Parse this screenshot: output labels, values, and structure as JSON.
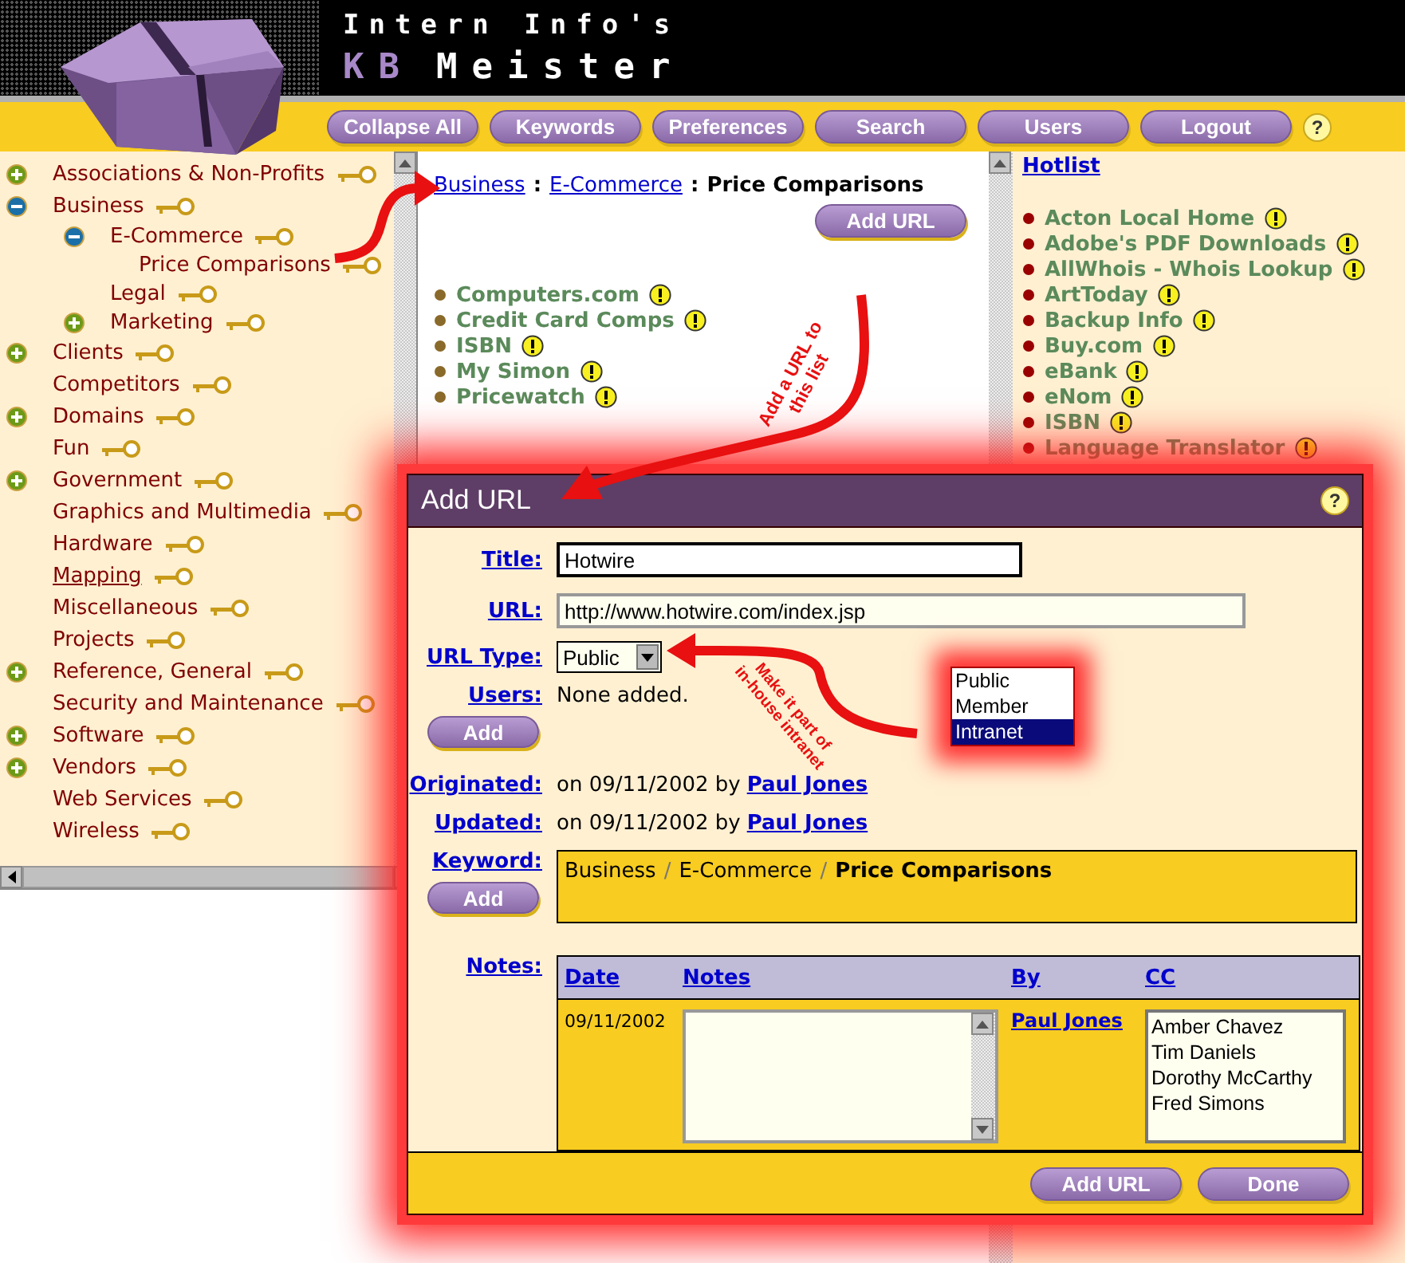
{
  "header": {
    "title": "Intern Info's",
    "product_prefix": "KB",
    "product_name": "Meister"
  },
  "toolbar": {
    "buttons": [
      "Collapse All",
      "Keywords",
      "Preferences",
      "Search",
      "Users",
      "Logout"
    ],
    "help": "?"
  },
  "tree": [
    {
      "label": "Associations & Non-Profits",
      "expanded": false,
      "hovered": false
    },
    {
      "label": "Business",
      "expanded": true,
      "hovered": false,
      "children": [
        {
          "label": "E-Commerce",
          "expanded": true,
          "hovered": false,
          "children": [
            {
              "label": "Price Comparisons",
              "hovered": false
            }
          ]
        },
        {
          "label": "Legal",
          "hovered": false
        },
        {
          "label": "Marketing",
          "expanded": false,
          "hovered": false
        }
      ]
    },
    {
      "label": "Clients",
      "expanded": false,
      "hovered": false
    },
    {
      "label": "Competitors",
      "hovered": false
    },
    {
      "label": "Domains",
      "expanded": false,
      "hovered": false
    },
    {
      "label": "Fun",
      "hovered": false
    },
    {
      "label": "Government",
      "expanded": false,
      "hovered": false
    },
    {
      "label": "Graphics and Multimedia",
      "hovered": false
    },
    {
      "label": "Hardware",
      "hovered": false
    },
    {
      "label": "Mapping",
      "hovered": true
    },
    {
      "label": "Miscellaneous",
      "hovered": false
    },
    {
      "label": "Projects",
      "hovered": false
    },
    {
      "label": "Reference, General",
      "expanded": false,
      "hovered": false
    },
    {
      "label": "Security and Maintenance",
      "hovered": false
    },
    {
      "label": "Software",
      "expanded": false,
      "hovered": false
    },
    {
      "label": "Vendors",
      "expanded": false,
      "hovered": false
    },
    {
      "label": "Web Services",
      "hovered": false
    },
    {
      "label": "Wireless",
      "hovered": false
    }
  ],
  "category": {
    "breadcrumb": [
      {
        "text": "Business",
        "kind": "link"
      },
      {
        "text": "E-Commerce",
        "kind": "link"
      },
      {
        "text": "Price Comparisons",
        "kind": "current"
      }
    ],
    "separator": ":",
    "add_button": "Add URL",
    "links": [
      "Computers.com",
      "Credit Card Comps",
      "ISBN",
      "My Simon",
      "Pricewatch"
    ]
  },
  "hotlist": {
    "title": "Hotlist",
    "links": [
      "Acton Local Home",
      "Adobe's PDF Downloads",
      "AllWhois - Whois Lookup",
      "ArtToday",
      "Backup Info",
      "Buy.com",
      "eBank",
      "eNom",
      "ISBN",
      "Language Translator"
    ]
  },
  "dialog": {
    "title": "Add URL",
    "help": "?",
    "title_label": "Title:",
    "title_value": "Hotwire",
    "url_label": "URL:",
    "url_value": "http://www.hotwire.com/index.jsp",
    "type_label": "URL Type:",
    "type_value": "Public",
    "users_label": "Users:",
    "users_value": "None added.",
    "users_add": "Add",
    "originated": {
      "label": "Originated:",
      "prefix": "on 09/11/2002 by",
      "user": "Paul Jones"
    },
    "updated": {
      "label": "Updated:",
      "prefix": "on 09/11/2002 by",
      "user": "Paul Jones"
    },
    "keyword_label": "Keyword:",
    "keyword_add": "Add",
    "keyword_path": [
      "Business",
      "E-Commerce",
      "Price Comparisons"
    ],
    "keyword_separator": "/",
    "notes_label": "Notes:",
    "notes_table": {
      "columns": [
        "Date",
        "Notes",
        "By",
        "CC"
      ],
      "date": "09/11/2002",
      "by": "Paul Jones",
      "cc": [
        "Amber Chavez",
        "Tim Daniels",
        "Dorothy McCarthy",
        "Fred Simons"
      ]
    },
    "buttons": [
      "Add URL",
      "Done"
    ]
  },
  "type_options": [
    {
      "label": "Public",
      "selected": false
    },
    {
      "label": "Member",
      "selected": false
    },
    {
      "label": "Intranet",
      "selected": true
    }
  ],
  "annotations": [
    {
      "text": "Add a URL to\nthis list"
    },
    {
      "text": "Make it part of\nin-house intranet"
    }
  ]
}
